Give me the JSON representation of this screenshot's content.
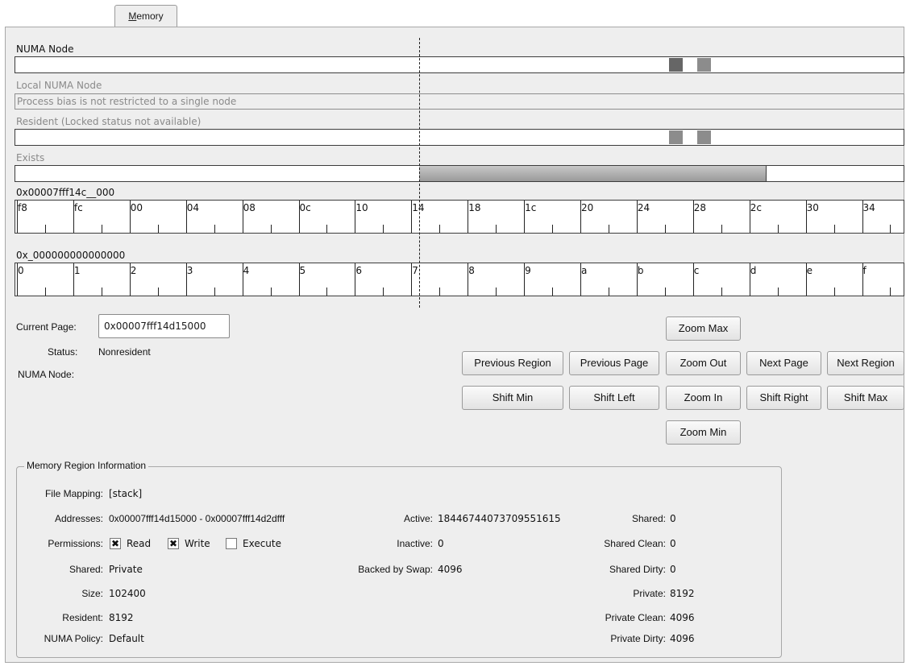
{
  "tab": {
    "label_underlined": "M",
    "label_rest": "emory"
  },
  "bars": {
    "numa_node_label": "NUMA Node",
    "local_numa_label": "Local NUMA Node",
    "local_numa_text": "Process bias is not restricted to a single node",
    "resident_label": "Resident (Locked status not available)",
    "exists_label": "Exists"
  },
  "ruler1": {
    "prefix": "0x00007fff14c__000",
    "ticks": [
      "f8",
      "fc",
      "00",
      "04",
      "08",
      "0c",
      "10",
      "14",
      "18",
      "1c",
      "20",
      "24",
      "28",
      "2c",
      "30",
      "34"
    ]
  },
  "ruler2": {
    "prefix": "0x_000000000000000",
    "ticks": [
      "0",
      "1",
      "2",
      "3",
      "4",
      "5",
      "6",
      "7",
      "8",
      "9",
      "a",
      "b",
      "c",
      "d",
      "e",
      "f"
    ]
  },
  "current_page": {
    "label": "Current Page:",
    "value": "0x00007fff14d15000"
  },
  "status": {
    "label": "Status:",
    "value": "Nonresident"
  },
  "numa_node": {
    "label": "NUMA Node:"
  },
  "buttons": {
    "zoom_max": "Zoom Max",
    "previous_region": "Previous Region",
    "previous_page": "Previous Page",
    "zoom_out": "Zoom Out",
    "next_page": "Next Page",
    "next_region": "Next Region",
    "shift_min": "Shift Min",
    "shift_left": "Shift Left",
    "zoom_in": "Zoom In",
    "shift_right": "Shift Right",
    "shift_max": "Shift Max",
    "zoom_min": "Zoom Min"
  },
  "region_info": {
    "title": "Memory Region Information",
    "file_mapping": {
      "label": "File Mapping:",
      "value": "[stack]"
    },
    "addresses": {
      "label": "Addresses:",
      "value": "0x00007fff14d15000 - 0x00007fff14d2dfff"
    },
    "permissions": {
      "label": "Permissions:",
      "read": {
        "label": "Read",
        "checked": true
      },
      "write": {
        "label": "Write",
        "checked": true
      },
      "execute": {
        "label": "Execute",
        "checked": false
      }
    },
    "shared": {
      "label": "Shared:",
      "value": "Private"
    },
    "size": {
      "label": "Size:",
      "value": "102400"
    },
    "resident": {
      "label": "Resident:",
      "value": "8192"
    },
    "numa_policy": {
      "label": "NUMA Policy:",
      "value": "Default"
    },
    "active": {
      "label": "Active:",
      "value": "18446744073709551615"
    },
    "inactive": {
      "label": "Inactive:",
      "value": "0"
    },
    "backed_by_swap": {
      "label": "Backed by Swap:",
      "value": "4096"
    },
    "shared_count": {
      "label": "Shared:",
      "value": "0"
    },
    "shared_clean": {
      "label": "Shared Clean:",
      "value": "0"
    },
    "shared_dirty": {
      "label": "Shared Dirty:",
      "value": "0"
    },
    "private": {
      "label": "Private:",
      "value": "8192"
    },
    "private_clean": {
      "label": "Private Clean:",
      "value": "4096"
    },
    "private_dirty": {
      "label": "Private Dirty:",
      "value": "4096"
    }
  },
  "colors": {
    "background": "#eeeeee",
    "bar_dark": "#666666",
    "bar_light": "#8c8c8c"
  }
}
